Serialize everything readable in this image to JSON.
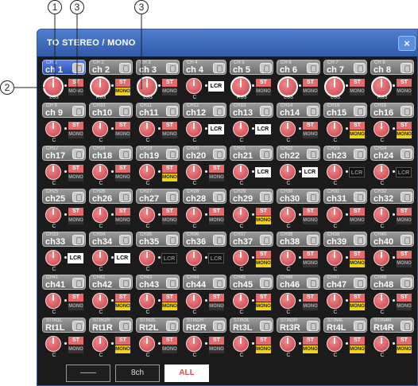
{
  "window": {
    "title": "TO STEREO / MONO",
    "close_label": "×"
  },
  "callouts": [
    "1",
    "2",
    "3",
    "3"
  ],
  "colors": {
    "title_bar": "#2f5aa8",
    "knob": "#c8404a",
    "st_on": "#e56a6a",
    "mono_on": "#f2d21a",
    "tab_active_text": "#e24a4a"
  },
  "rows": [
    {
      "channels": [
        {
          "small": "CH 1",
          "big": "ch 1",
          "pan": "L63",
          "mode": "st",
          "mono": false,
          "selected": true,
          "big_knob": true
        },
        {
          "small": "CH 2",
          "big": "ch 2",
          "pan": "R63",
          "mode": "st",
          "mono": true,
          "selected": false,
          "big_knob": true
        },
        {
          "small": "CH 3",
          "big": "ch 3",
          "pan": "L63",
          "mode": "st",
          "mono": false,
          "selected": false,
          "big_knob": true
        },
        {
          "small": "CH 4",
          "big": "ch 4",
          "pan": "C",
          "mode": "lcr",
          "lcr_on": true
        },
        {
          "small": "CH 5",
          "big": "ch 5",
          "pan": "R63",
          "mode": "st",
          "mono": false,
          "big_knob": true
        },
        {
          "small": "CH 6",
          "big": "ch 6",
          "pan": "L63",
          "mode": "st",
          "mono": false,
          "big_knob": true
        },
        {
          "small": "CH 7",
          "big": "ch 7",
          "pan": "L63",
          "mode": "st",
          "mono": false,
          "big_knob": true
        },
        {
          "small": "CH 8",
          "big": "ch 8",
          "pan": "R63",
          "mode": "st",
          "mono": false,
          "big_knob": true
        }
      ]
    },
    {
      "channels": [
        {
          "small": "CH 9",
          "big": "ch 9",
          "pan": "C",
          "mode": "st",
          "mono": false
        },
        {
          "small": "CH10",
          "big": "ch10",
          "pan": "C",
          "mode": "st",
          "mono": false
        },
        {
          "small": "CH11",
          "big": "ch11",
          "pan": "C",
          "mode": "st",
          "mono": false
        },
        {
          "small": "CH12",
          "big": "ch12",
          "pan": "C",
          "mode": "lcr",
          "lcr_on": true
        },
        {
          "small": "CH13",
          "big": "ch13",
          "pan": "C",
          "mode": "lcr",
          "lcr_on": true
        },
        {
          "small": "CH14",
          "big": "ch14",
          "pan": "C",
          "mode": "st",
          "mono": false
        },
        {
          "small": "CH15",
          "big": "ch15",
          "pan": "C",
          "mode": "st",
          "mono": true
        },
        {
          "small": "CH16",
          "big": "ch16",
          "pan": "C",
          "mode": "st",
          "mono": true
        }
      ]
    },
    {
      "channels": [
        {
          "small": "CH17",
          "big": "ch17",
          "pan": "C",
          "mode": "st",
          "mono": false
        },
        {
          "small": "CH18",
          "big": "ch18",
          "pan": "C",
          "mode": "st",
          "mono": false
        },
        {
          "small": "CH19",
          "big": "ch19",
          "pan": "C",
          "mode": "st",
          "mono": true
        },
        {
          "small": "CH20",
          "big": "ch20",
          "pan": "C",
          "mode": "st",
          "mono": false
        },
        {
          "small": "CH21",
          "big": "ch21",
          "pan": "C",
          "mode": "lcr",
          "lcr_on": true
        },
        {
          "small": "CH22",
          "big": "ch22",
          "pan": "C",
          "mode": "lcr",
          "lcr_on": true
        },
        {
          "small": "CH23",
          "big": "ch23",
          "pan": "C",
          "mode": "lcr",
          "lcr_on": false
        },
        {
          "small": "CH24",
          "big": "ch24",
          "pan": "C",
          "mode": "lcr",
          "lcr_on": false
        }
      ]
    },
    {
      "channels": [
        {
          "small": "CH25",
          "big": "ch25",
          "pan": "C",
          "mode": "st",
          "mono": false
        },
        {
          "small": "CH26",
          "big": "ch26",
          "pan": "C",
          "mode": "st",
          "mono": false
        },
        {
          "small": "CH27",
          "big": "ch27",
          "pan": "C",
          "mode": "st",
          "mono": false
        },
        {
          "small": "CH28",
          "big": "ch28",
          "pan": "C",
          "mode": "st",
          "mono": false
        },
        {
          "small": "CH29",
          "big": "ch29",
          "pan": "C",
          "mode": "st",
          "mono": true
        },
        {
          "small": "CH30",
          "big": "ch30",
          "pan": "C",
          "mode": "st",
          "mono": false
        },
        {
          "small": "CH31",
          "big": "ch31",
          "pan": "C",
          "mode": "st",
          "mono": false
        },
        {
          "small": "CH32",
          "big": "ch32",
          "pan": "C",
          "mode": "st",
          "mono": false
        }
      ]
    },
    {
      "channels": [
        {
          "small": "CH33",
          "big": "ch33",
          "pan": "C",
          "mode": "lcr",
          "lcr_on": true
        },
        {
          "small": "CH34",
          "big": "ch34",
          "pan": "C",
          "mode": "lcr",
          "lcr_on": true
        },
        {
          "small": "CH35",
          "big": "ch35",
          "pan": "C",
          "mode": "lcr",
          "lcr_on": false
        },
        {
          "small": "CH36",
          "big": "ch36",
          "pan": "C",
          "mode": "lcr",
          "lcr_on": false
        },
        {
          "small": "CH37",
          "big": "ch37",
          "pan": "C",
          "mode": "st",
          "mono": true
        },
        {
          "small": "CH38",
          "big": "ch38",
          "pan": "C",
          "mode": "st",
          "mono": false
        },
        {
          "small": "CH39",
          "big": "ch39",
          "pan": "C",
          "mode": "st",
          "mono": true
        },
        {
          "small": "CH40",
          "big": "ch40",
          "pan": "C",
          "mode": "st",
          "mono": false
        }
      ]
    },
    {
      "channels": [
        {
          "small": "CH41",
          "big": "ch41",
          "pan": "C",
          "mode": "st",
          "mono": false
        },
        {
          "small": "CH42",
          "big": "ch42",
          "pan": "C",
          "mode": "st",
          "mono": true
        },
        {
          "small": "CH43",
          "big": "ch43",
          "pan": "C",
          "mode": "st",
          "mono": true
        },
        {
          "small": "CH44",
          "big": "ch44",
          "pan": "C",
          "mode": "st",
          "mono": false
        },
        {
          "small": "CH45",
          "big": "ch45",
          "pan": "C",
          "mode": "st",
          "mono": true
        },
        {
          "small": "CH46",
          "big": "ch46",
          "pan": "C",
          "mode": "st",
          "mono": false
        },
        {
          "small": "CH47",
          "big": "ch47",
          "pan": "C",
          "mode": "st",
          "mono": true
        },
        {
          "small": "CH48",
          "big": "ch48",
          "pan": "C",
          "mode": "st",
          "mono": false
        }
      ]
    },
    {
      "channels": [
        {
          "small": "STIN1L",
          "big": "Rt1L",
          "pan": "C",
          "mode": "st",
          "mono": false
        },
        {
          "small": "STIN1R",
          "big": "Rt1R",
          "pan": "C",
          "mode": "st",
          "mono": true
        },
        {
          "small": "STIN2L",
          "big": "Rt2L",
          "pan": "C",
          "mode": "st",
          "mono": false
        },
        {
          "small": "STIN2R",
          "big": "Rt2R",
          "pan": "C",
          "mode": "st",
          "mono": false
        },
        {
          "small": "STIN3L",
          "big": "Rt3L",
          "pan": "C",
          "mode": "st",
          "mono": true
        },
        {
          "small": "STIN3R",
          "big": "Rt3R",
          "pan": "C",
          "mode": "st",
          "mono": true
        },
        {
          "small": "STIN4L",
          "big": "Rt4L",
          "pan": "C",
          "mode": "st",
          "mono": true
        },
        {
          "small": "STIN4R",
          "big": "Rt4R",
          "pan": "C",
          "mode": "st",
          "mono": true
        }
      ]
    }
  ],
  "labels": {
    "st": "ST",
    "mono": "MONO",
    "lcr": "LCR"
  },
  "tabs": [
    {
      "label": "——",
      "active": false
    },
    {
      "label": "8ch",
      "active": false
    },
    {
      "label": "ALL",
      "active": true
    }
  ]
}
